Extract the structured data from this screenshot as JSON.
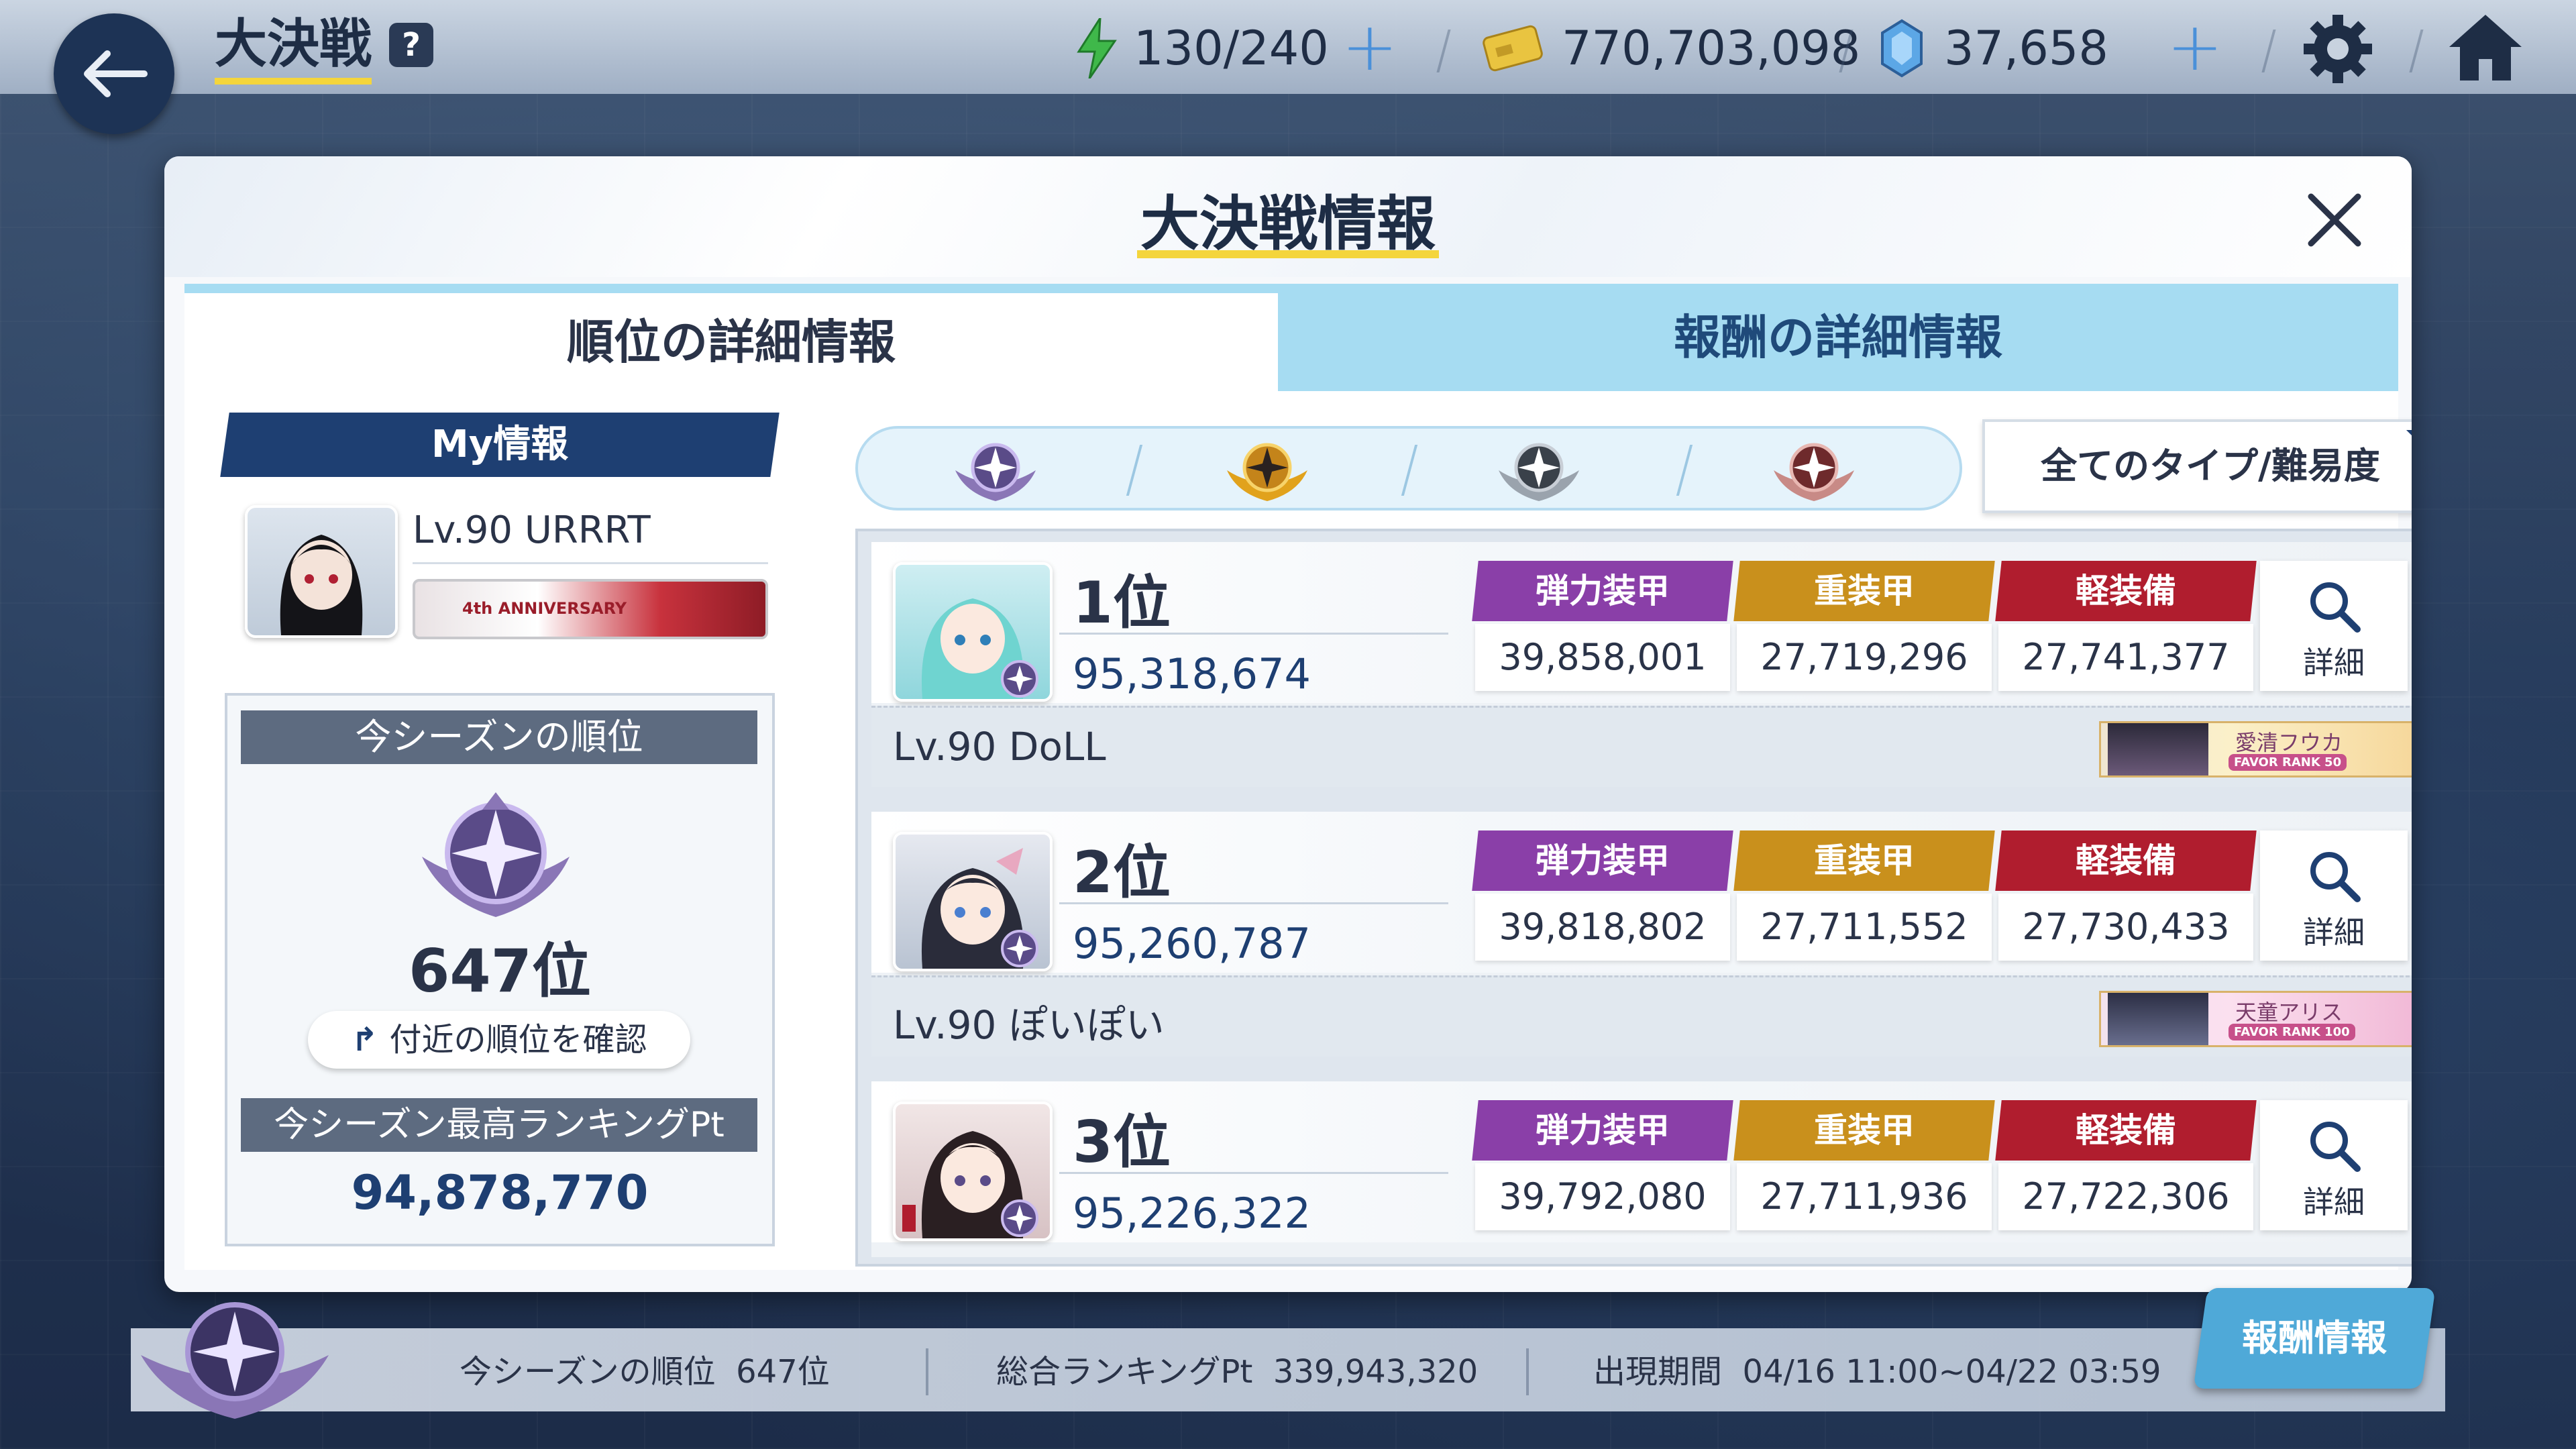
{
  "header": {
    "title": "大決戦",
    "help_label": "?",
    "ap": "130/240",
    "credits": "770,703,098",
    "gems": "37,658"
  },
  "modal": {
    "title": "大決戦情報",
    "tabs": [
      {
        "label": "順位の詳細情報",
        "active": true
      },
      {
        "label": "報酬の詳細情報",
        "active": false
      }
    ]
  },
  "my_info": {
    "header": "My情報",
    "name": "Lv.90 URRRT",
    "banner_text": "4th ANNIVERSARY",
    "season_rank_label": "今シーズンの順位",
    "season_rank": "647位",
    "nearby_button": "付近の順位を確認",
    "best_pt_label": "今シーズン最高ランキングPt",
    "best_pt": "94,878,770"
  },
  "filter": {
    "label": "全てのタイプ/難易度",
    "difficulties": [
      "insane",
      "torment",
      "extreme",
      "hardcore"
    ]
  },
  "type_labels": {
    "explosive": "弾力装甲",
    "heavy": "重装甲",
    "light": "軽装備"
  },
  "colors": {
    "explosive": "#8a3fa8",
    "heavy": "#c9901c",
    "light": "#b01d2e"
  },
  "detail_label": "詳細",
  "rankings": [
    {
      "position": "1位",
      "points": "95,318,674",
      "scores": {
        "explosive": "39,858,001",
        "heavy": "27,719,296",
        "light": "27,741,377"
      },
      "player": "Lv.90 DoLL",
      "favor": {
        "name": "愛清フウカ",
        "rank": "FAVOR RANK 50"
      }
    },
    {
      "position": "2位",
      "points": "95,260,787",
      "scores": {
        "explosive": "39,818,802",
        "heavy": "27,711,552",
        "light": "27,730,433"
      },
      "player": "Lv.90 ぽいぽい",
      "favor": {
        "name": "天童アリス",
        "rank": "FAVOR RANK 100"
      }
    },
    {
      "position": "3位",
      "points": "95,226,322",
      "scores": {
        "explosive": "39,792,080",
        "heavy": "27,711,936",
        "light": "27,722,306"
      },
      "player": "",
      "favor": {
        "name": "",
        "rank": ""
      }
    }
  ],
  "footer": {
    "season_rank_label": "今シーズンの順位",
    "season_rank": "647位",
    "total_pt_label": "総合ランキングPt",
    "total_pt": "339,943,320",
    "period_label": "出現期間",
    "period": "04/16 11:00~04/22 03:59",
    "reward_button": "報酬情報"
  }
}
